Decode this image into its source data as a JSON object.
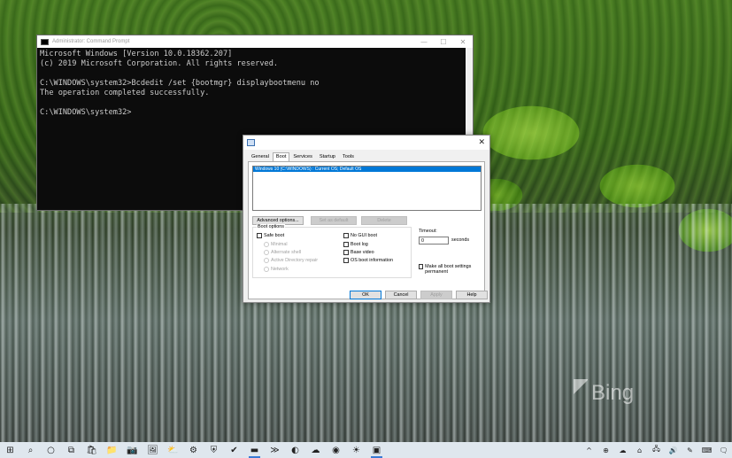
{
  "cmd": {
    "title": "Administrator: Command Prompt",
    "controls": {
      "min": "—",
      "max": "☐",
      "close": "✕"
    },
    "lines": [
      "Microsoft Windows [Version 10.0.18362.207]",
      "(c) 2019 Microsoft Corporation. All rights reserved.",
      "",
      "C:\\WINDOWS\\system32>Bcdedit /set {bootmgr} displaybootmenu no",
      "The operation completed successfully.",
      "",
      "C:\\WINDOWS\\system32>"
    ]
  },
  "dialog": {
    "close": "✕",
    "tabs": [
      "General",
      "Boot",
      "Services",
      "Startup",
      "Tools"
    ],
    "active_tab": "Boot",
    "os_entry": "Windows 10 (C:\\WINDOWS) : Current OS; Default OS",
    "buttons": {
      "advanced": "Advanced options...",
      "set_default": "Set as default",
      "delete": "Delete"
    },
    "boot_options_label": "Boot options",
    "safe_boot": "Safe boot",
    "radios": [
      "Minimal",
      "Alternate shell",
      "Active Directory repair",
      "Network"
    ],
    "right_checks": [
      "No GUI boot",
      "Boot log",
      "Base video",
      "OS boot information"
    ],
    "timeout_label": "Timeout:",
    "timeout_value": "0",
    "seconds": "seconds",
    "make_permanent": "Make all boot settings permanent",
    "footer": {
      "ok": "OK",
      "cancel": "Cancel",
      "apply": "Apply",
      "help": "Help"
    }
  },
  "watermark": "Bing",
  "taskbar": {
    "icons": [
      "windows-icon",
      "search-icon",
      "cortana-icon",
      "task-view-icon",
      "store-icon",
      "file-explorer-icon",
      "camera-icon",
      "photos-icon",
      "weather-icon",
      "settings-icon",
      "shield-icon",
      "todo-icon",
      "terminal-icon",
      "powershell-icon",
      "edge-icon",
      "skype-icon",
      "chrome-icon",
      "tips-icon",
      "msconfig-icon"
    ],
    "glyphs": [
      "⊞",
      "⌕",
      "○",
      "⧉",
      "🛍",
      "📁",
      "📷",
      "🖼",
      "⛅",
      "⚙",
      "⛨",
      "✔",
      "▬",
      "≫",
      "◐",
      "☁",
      "◉",
      "☀",
      "▣"
    ],
    "tray": [
      "^",
      "⊕",
      "☁",
      "⌂",
      "🖧",
      "🔊",
      "✎",
      "⌨",
      "🗨"
    ]
  }
}
